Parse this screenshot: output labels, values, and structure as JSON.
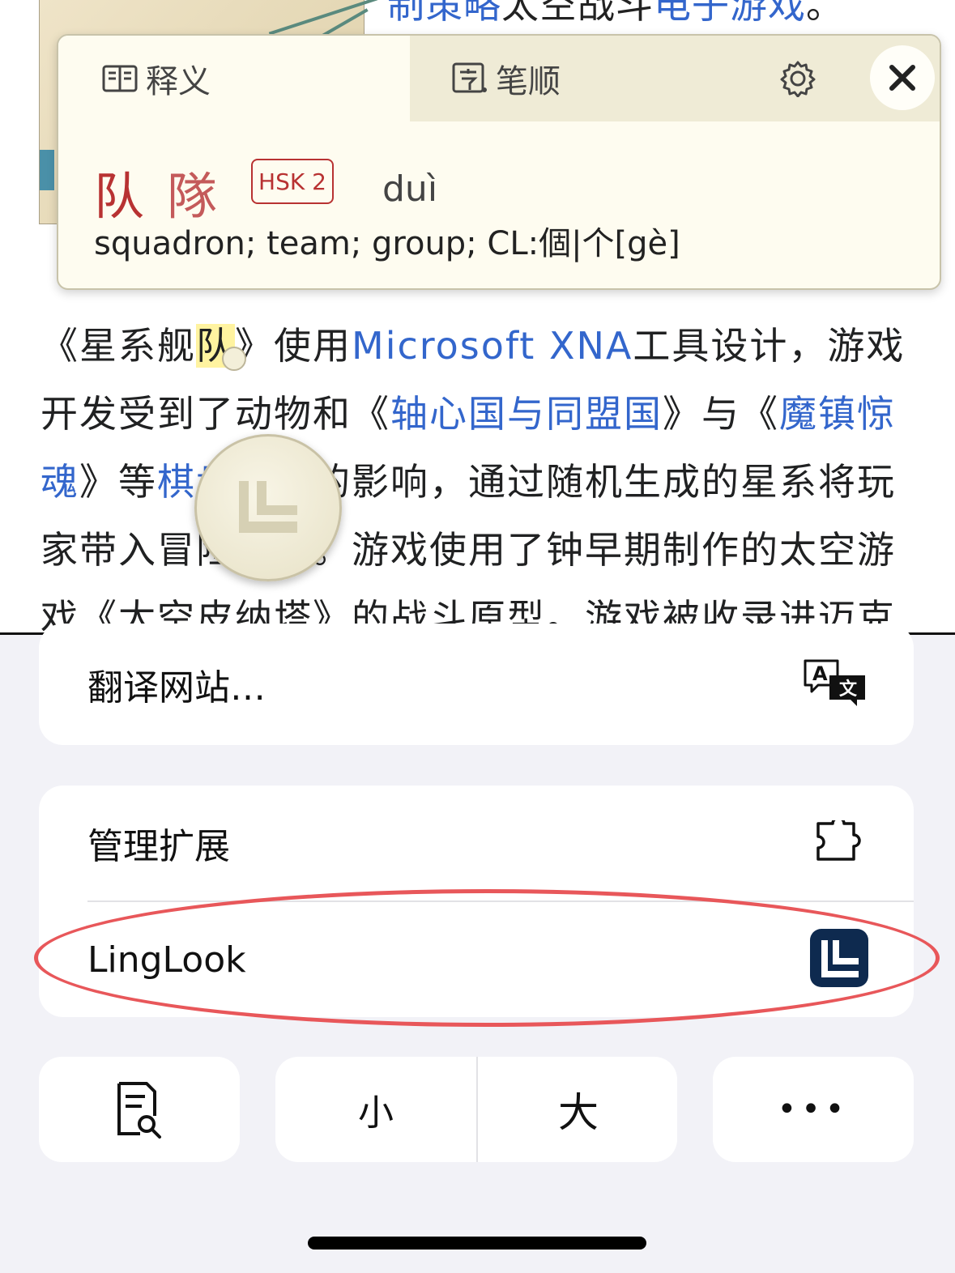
{
  "article": {
    "top_line": {
      "a": "制策略",
      "b": "太空战斗",
      "c": "电子游戏",
      "d": "。"
    },
    "hidden_line": "…",
    "para": [
      {
        "t": "《星系舰",
        "link": false
      },
      {
        "t": "队",
        "link": false,
        "highlight": true
      },
      {
        "t": "》使用",
        "link": false
      },
      {
        "t": "Microsoft XNA",
        "link": true
      },
      {
        "t": "工具设计，游戏开发受到了动物和《",
        "link": false
      },
      {
        "t": "轴心国与同盟国",
        "link": true
      },
      {
        "t": "》与《",
        "link": false
      },
      {
        "t": "魔镇惊魂",
        "link": true
      },
      {
        "t": "》等",
        "link": false
      },
      {
        "t": "棋盘游戏",
        "link": true
      },
      {
        "t": "的影响，通过随机生成的星系将玩家带入冒险之中。游戏使用了钟早期制作的太空游戏《太空皮纳塔》的战斗原型。游戏被收录进迈克",
        "link": false
      }
    ]
  },
  "popup": {
    "tab_definition": "释义",
    "tab_stroke": "笔顺",
    "simplified": "队",
    "traditional": "隊",
    "hsk": "HSK 2",
    "pinyin": "duì",
    "meaning": "squadron; team; group; CL:個|个[gè]"
  },
  "sheet": {
    "translate_label": "翻译网站…",
    "manage_ext_label": "管理扩展",
    "linglook_label": "LingLook",
    "small_label": "小",
    "big_label": "大",
    "more_label": "•••"
  },
  "colors": {
    "accent_red": "#b83232",
    "link_blue": "#3366cc",
    "highlight_oval": "#e8575a",
    "linglook_icon_bg": "#0e2a4f"
  }
}
